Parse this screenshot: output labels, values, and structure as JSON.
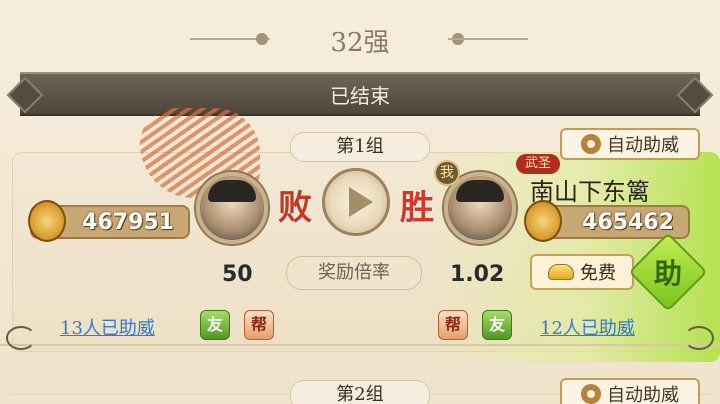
{
  "round": {
    "title": "32强"
  },
  "status": {
    "text": "已结束"
  },
  "groups": [
    {
      "label": "第1组",
      "auto_cheer_label": "自动助威",
      "left": {
        "score": "467951",
        "result": "败",
        "multiplier": "50",
        "cheer_count": "13人已助威",
        "friend_tag": "友",
        "guild_tag": "帮"
      },
      "right": {
        "me_badge": "我",
        "title_badge": "武圣",
        "name": "南山下东篱",
        "score": "465462",
        "result": "胜",
        "multiplier": "1.02",
        "cheer_count": "12人已助威",
        "friend_tag": "友",
        "guild_tag": "帮",
        "free_label": "免费",
        "cheer_button": "助"
      },
      "reward_label": "奖励倍率"
    },
    {
      "label": "第2组",
      "auto_cheer_label": "自动助威"
    }
  ],
  "colors": {
    "lose": "#c9361e",
    "win": "#d6352a",
    "link": "#2f7bd6",
    "accent_green": "#78c41b"
  },
  "icons": [
    "gear-icon",
    "sword-icon",
    "play-icon",
    "ingot-icon"
  ]
}
